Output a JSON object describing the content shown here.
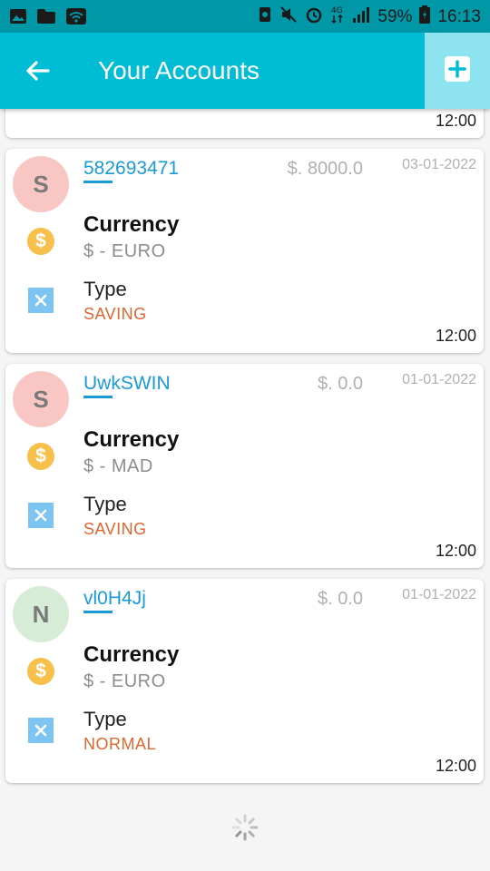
{
  "status_bar": {
    "icons_left": [
      "image-icon",
      "folder-icon",
      "wifi-icon"
    ],
    "icons_right": [
      "nfc-icon",
      "mute-icon",
      "alarm-icon",
      "lte-icon",
      "signal-icon"
    ],
    "battery": "59%",
    "time": "16:13"
  },
  "header": {
    "title": "Your Accounts",
    "back_icon": "arrow-left-icon",
    "add_icon": "plus-square-icon"
  },
  "partial_card": {
    "time": "12:00"
  },
  "accounts": [
    {
      "avatar_letter": "S",
      "avatar_color": "#f9c7c3",
      "number": "582693471",
      "balance": "$. 8000.0",
      "date": "03-01-2022",
      "currency_label": "Currency",
      "currency_value": "$ - EURO",
      "type_label": "Type",
      "type_value": "SAVING",
      "time": "12:00"
    },
    {
      "avatar_letter": "S",
      "avatar_color": "#f9c7c3",
      "number": "UwkSWIN",
      "balance": "$. 0.0",
      "date": "01-01-2022",
      "currency_label": "Currency",
      "currency_value": "$ - MAD",
      "type_label": "Type",
      "type_value": "SAVING",
      "time": "12:00"
    },
    {
      "avatar_letter": "N",
      "avatar_color": "#d6ecd6",
      "number": "vl0H4Jj",
      "balance": "$. 0.0",
      "date": "01-01-2022",
      "currency_label": "Currency",
      "currency_value": "$ - EURO",
      "type_label": "Type",
      "type_value": "NORMAL",
      "time": "12:00"
    }
  ],
  "colors": {
    "primary": "#00bcd4",
    "status_bar": "#0097a7",
    "link": "#1a9bd8",
    "type_value": "#e0652e",
    "currency_icon": "#f7c04a",
    "type_icon": "#7ec4f3"
  }
}
